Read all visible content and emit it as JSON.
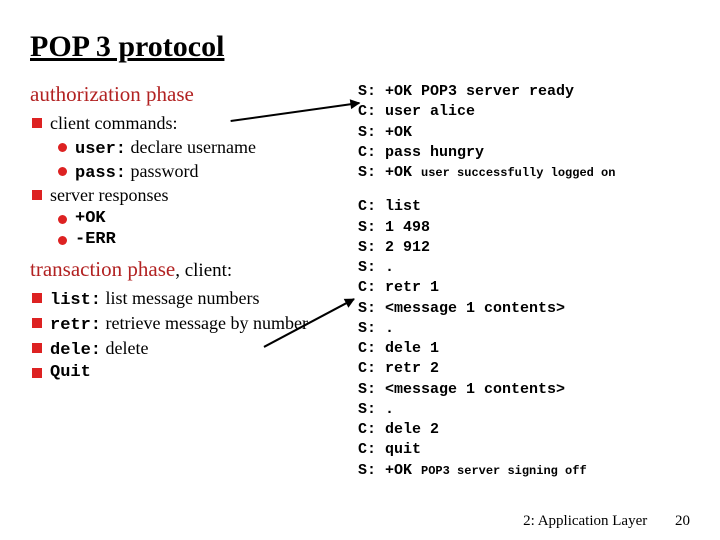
{
  "title": "POP 3 protocol",
  "subhead_auth": "authorization phase",
  "auth_items": {
    "cmds_label": "client commands:",
    "user_cmd": "user:",
    "user_desc": " declare username",
    "pass_cmd": "pass:",
    "pass_desc": " password",
    "srv_label": "server responses",
    "ok": "+OK",
    "err": "-ERR"
  },
  "subhead_trans": "transaction phase",
  "subhead_trans_tail": ", client:",
  "trans_items": {
    "list_cmd": "list:",
    "list_desc": " list message numbers",
    "retr_cmd": "retr:",
    "retr_desc": " retrieve message by number",
    "dele_cmd": "dele:",
    "dele_desc": " delete",
    "quit_cmd": "Quit"
  },
  "session1": [
    {
      "p": "S:",
      "t": " +OK POP3 server ready"
    },
    {
      "p": "C:",
      "t": " user alice"
    },
    {
      "p": "S:",
      "t": " +OK"
    },
    {
      "p": "C:",
      "t": " pass hungry"
    },
    {
      "p": "S:",
      "t": " +OK ",
      "s": "user successfully logged on"
    }
  ],
  "session2": [
    {
      "p": "C:",
      "t": " list"
    },
    {
      "p": "S:",
      "t": " 1 498"
    },
    {
      "p": "S:",
      "t": " 2 912"
    },
    {
      "p": "S:",
      "t": " ."
    },
    {
      "p": "C:",
      "t": " retr 1"
    },
    {
      "p": "S:",
      "t": " <message 1 contents>"
    },
    {
      "p": "S:",
      "t": " ."
    },
    {
      "p": "C:",
      "t": " dele 1"
    },
    {
      "p": "C:",
      "t": " retr 2"
    },
    {
      "p": "S:",
      "t": " <message 1 contents>"
    },
    {
      "p": "S:",
      "t": " ."
    },
    {
      "p": "C:",
      "t": " dele 2"
    },
    {
      "p": "C:",
      "t": " quit"
    },
    {
      "p": "S:",
      "t": " +OK ",
      "s": "POP3 server signing off"
    }
  ],
  "footer_text": "2: Application Layer",
  "page_number": "20"
}
